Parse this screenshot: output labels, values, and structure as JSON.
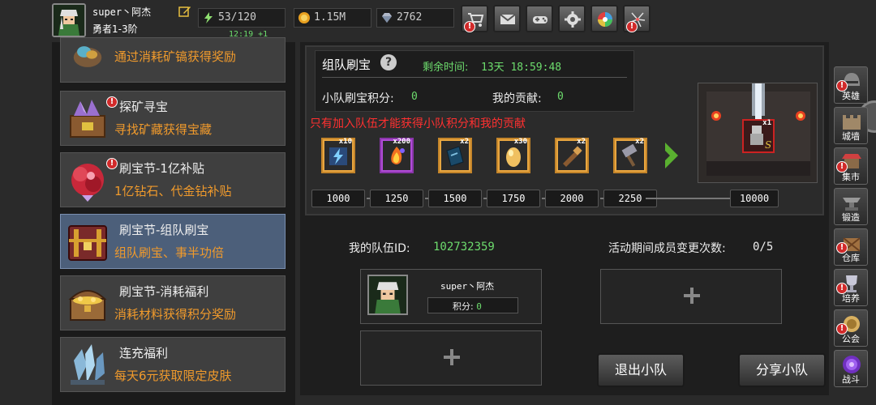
{
  "player": {
    "name": "super丶阿杰",
    "rank": "勇者1-3阶"
  },
  "resources": {
    "stamina": "53/120",
    "stamina_timer": "12:19 +1",
    "gold": "1.15M",
    "diamonds": "2762"
  },
  "top_buttons": [
    "shop-cart-icon",
    "mail-icon",
    "gamepad-icon",
    "settings-gear-icon",
    "color-wheel-icon",
    "fireworks-icon"
  ],
  "events": [
    {
      "title": "",
      "desc": "通过消耗矿镐获得奖励",
      "alert": false
    },
    {
      "title": "探矿寻宝",
      "desc": "寻找矿藏获得宝藏",
      "alert": true
    },
    {
      "title": "刷宝节-1亿补贴",
      "desc": "1亿钻石、代金钻补贴",
      "alert": true
    },
    {
      "title": "刷宝节-组队刷宝",
      "desc": "组队刷宝、事半功倍",
      "alert": false,
      "selected": true
    },
    {
      "title": "刷宝节-消耗福利",
      "desc": "消耗材料获得积分奖励",
      "alert": false
    },
    {
      "title": "连充福利",
      "desc": "每天6元获取限定皮肤",
      "alert": false
    }
  ],
  "panel": {
    "title": "组队刷宝",
    "timer_label": "剩余时间:",
    "timer_value": "13天 18:59:48",
    "team_score_label": "小队刷宝积分:",
    "team_score_value": "0",
    "my_contrib_label": "我的贡献:",
    "my_contrib_value": "0",
    "notice": "只有加入队伍才能获得小队积分和我的贡献"
  },
  "reward_tiers": [
    {
      "qty": "x10",
      "icon": "lightning-scroll-icon",
      "color": "orange"
    },
    {
      "qty": "x200",
      "icon": "fire-essence-icon",
      "color": "purple"
    },
    {
      "qty": "x2",
      "icon": "spellbook-icon",
      "color": "orange"
    },
    {
      "qty": "x30",
      "icon": "golden-egg-icon",
      "color": "orange"
    },
    {
      "qty": "x2",
      "icon": "telescope-scroll-icon",
      "color": "orange"
    },
    {
      "qty": "x2",
      "icon": "war-hammer-icon",
      "color": "orange"
    }
  ],
  "thresholds": [
    "1000",
    "1250",
    "1500",
    "1750",
    "2000",
    "2250",
    "10000"
  ],
  "final_reward": {
    "qty": "x1",
    "grade": "S"
  },
  "team": {
    "id_label": "我的队伍ID:",
    "id_value": "102732359",
    "change_label": "活动期间成员变更次数:",
    "change_value": "0/5",
    "member": {
      "name": "super丶阿杰",
      "score_label": "积分:",
      "score_value": "0"
    }
  },
  "buttons": {
    "leave": "退出小队",
    "share": "分享小队"
  },
  "nav": [
    {
      "label": "英雄",
      "alert": true
    },
    {
      "label": "城墙",
      "alert": false
    },
    {
      "label": "集市",
      "alert": true
    },
    {
      "label": "锻造",
      "alert": false
    },
    {
      "label": "仓库",
      "alert": true
    },
    {
      "label": "培养",
      "alert": true
    },
    {
      "label": "公会",
      "alert": true
    },
    {
      "label": "战斗",
      "alert": false
    }
  ],
  "colors": {
    "accent_green": "#6ddc6d",
    "notice_red": "#ff3030",
    "desc_orange": "#f09a2c",
    "selected_bg": "#4c5f7a"
  }
}
